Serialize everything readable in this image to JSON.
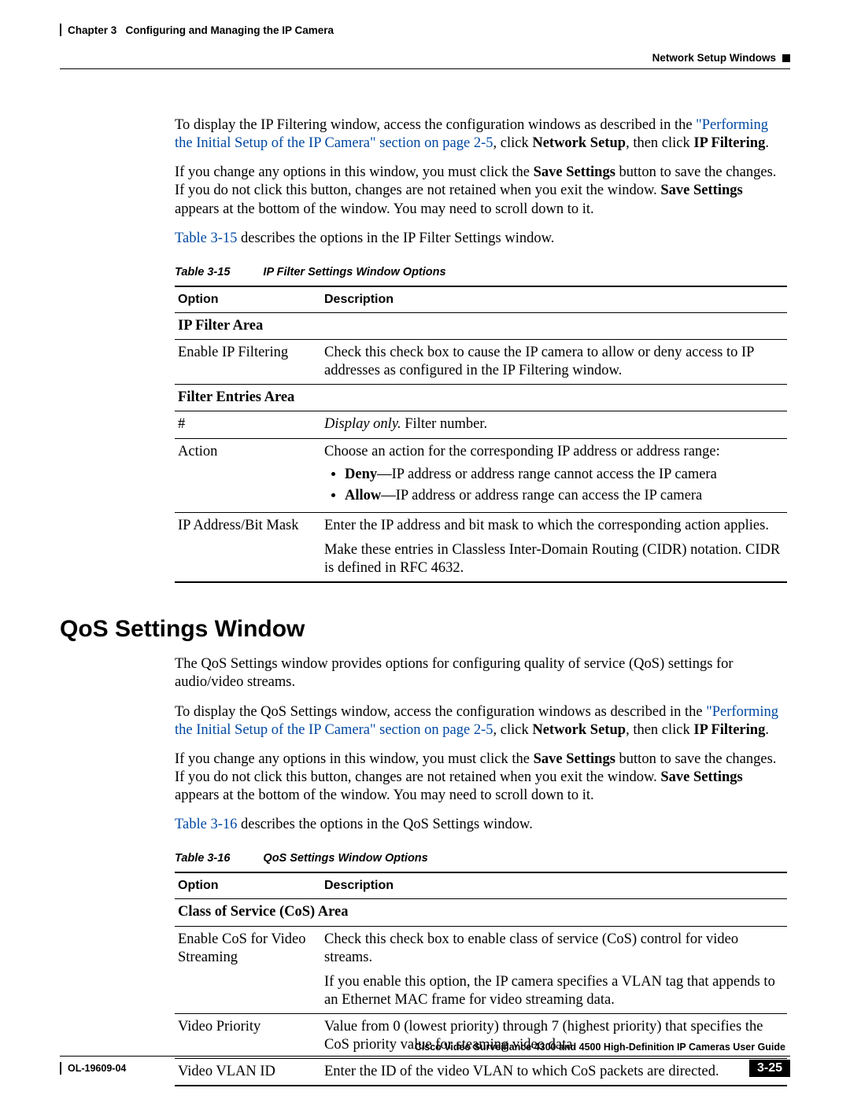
{
  "header": {
    "chapter_label": "Chapter 3",
    "chapter_title": "Configuring and Managing the IP Camera",
    "section_title": "Network Setup Windows"
  },
  "intro1": {
    "pre": "To display the IP Filtering window, access the configuration windows as described in the ",
    "link": "\"Performing the Initial Setup of the IP Camera\" section on page 2-5",
    "post": ", click ",
    "bold1": "Network Setup",
    "mid": ", then click ",
    "bold2": "IP Filtering",
    "end": "."
  },
  "intro2": {
    "p1a": "If you change any options in this window, you must click the ",
    "p1b": "Save Settings",
    "p1c": " button to save the changes. If you do not click this button, changes are not retained when you exit the window. ",
    "p1d": "Save Settings",
    "p1e": " appears at the bottom of the window. You may need to scroll down to it."
  },
  "intro3": {
    "link": "Table 3-15",
    "rest": " describes the options in the IP Filter Settings window."
  },
  "table15": {
    "caption_num": "Table 3-15",
    "caption_title": "IP Filter Settings Window Options",
    "headers": {
      "option": "Option",
      "description": "Description"
    },
    "section1": "IP Filter Area",
    "row1": {
      "opt": "Enable IP Filtering",
      "desc": "Check this check box to cause the IP camera to allow or deny access to IP addresses as configured in the IP Filtering window."
    },
    "section2": "Filter Entries Area",
    "row2": {
      "opt": "#",
      "desc_em": "Display only.",
      "desc_rest": " Filter number."
    },
    "row3": {
      "opt": "Action",
      "lead": "Choose an action for the corresponding IP address or address range:",
      "li1_b": "Deny",
      "li1_r": "—IP address or address range cannot access the IP camera",
      "li2_b": "Allow",
      "li2_r": "—IP address or address range can access the IP camera"
    },
    "row4": {
      "opt": "IP Address/Bit Mask",
      "p1": "Enter the IP address and bit mask to which the corresponding action applies.",
      "p2": "Make these entries in Classless Inter-Domain Routing (CIDR) notation. CIDR is defined in RFC 4632."
    }
  },
  "qos_heading": "QoS Settings Window",
  "qos_p1": "The QoS Settings window provides options for configuring quality of service (QoS) settings for audio/video streams.",
  "qos_intro1": {
    "pre": "To display the QoS Settings window, access the configuration windows as described in the ",
    "link": "\"Performing the Initial Setup of the IP Camera\" section on page 2-5",
    "post": ", click ",
    "bold1": "Network Setup",
    "mid": ", then click ",
    "bold2": "IP Filtering",
    "end": "."
  },
  "qos_intro2": {
    "p1a": "If you change any options in this window, you must click the ",
    "p1b": "Save Settings",
    "p1c": " button to save the changes. If you do not click this button, changes are not retained when you exit the window. ",
    "p1d": "Save Settings",
    "p1e": " appears at the bottom of the window. You may need to scroll down to it."
  },
  "qos_intro3": {
    "link": "Table 3-16",
    "rest": " describes the options in the QoS Settings window."
  },
  "table16": {
    "caption_num": "Table 3-16",
    "caption_title": "QoS Settings Window Options",
    "headers": {
      "option": "Option",
      "description": "Description"
    },
    "section1": "Class of Service (CoS) Area",
    "row1": {
      "opt": "Enable CoS for Video Streaming",
      "p1": "Check this check box to enable class of service (CoS) control for video streams.",
      "p2": "If you enable this option, the IP camera specifies a VLAN tag that appends to an Ethernet MAC frame for video streaming data."
    },
    "row2": {
      "opt": "Video Priority",
      "desc": "Value from 0 (lowest priority) through 7 (highest priority) that specifies the CoS priority value for steaming video data."
    },
    "row3": {
      "opt": "Video VLAN ID",
      "desc": "Enter the ID of the video VLAN to which CoS packets are directed."
    }
  },
  "footer": {
    "doc_title": "Cisco Video Surveillance 4300 and 4500 High-Definition IP Cameras User Guide",
    "doc_number": "OL-19609-04",
    "page_number": "3-25"
  }
}
